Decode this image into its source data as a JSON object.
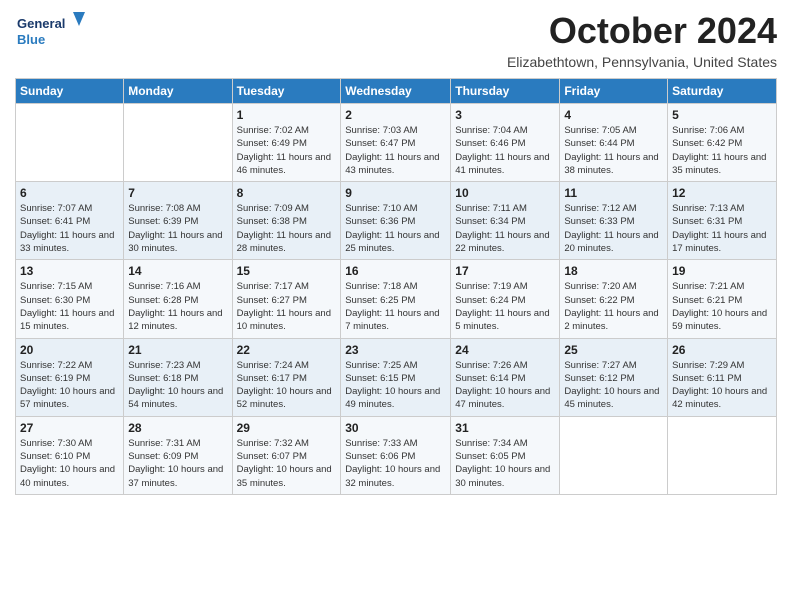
{
  "logo": {
    "general": "General",
    "blue": "Blue"
  },
  "header": {
    "month": "October 2024",
    "location": "Elizabethtown, Pennsylvania, United States"
  },
  "days_of_week": [
    "Sunday",
    "Monday",
    "Tuesday",
    "Wednesday",
    "Thursday",
    "Friday",
    "Saturday"
  ],
  "weeks": [
    [
      {
        "day": "",
        "info": ""
      },
      {
        "day": "",
        "info": ""
      },
      {
        "day": "1",
        "info": "Sunrise: 7:02 AM\nSunset: 6:49 PM\nDaylight: 11 hours and 46 minutes."
      },
      {
        "day": "2",
        "info": "Sunrise: 7:03 AM\nSunset: 6:47 PM\nDaylight: 11 hours and 43 minutes."
      },
      {
        "day": "3",
        "info": "Sunrise: 7:04 AM\nSunset: 6:46 PM\nDaylight: 11 hours and 41 minutes."
      },
      {
        "day": "4",
        "info": "Sunrise: 7:05 AM\nSunset: 6:44 PM\nDaylight: 11 hours and 38 minutes."
      },
      {
        "day": "5",
        "info": "Sunrise: 7:06 AM\nSunset: 6:42 PM\nDaylight: 11 hours and 35 minutes."
      }
    ],
    [
      {
        "day": "6",
        "info": "Sunrise: 7:07 AM\nSunset: 6:41 PM\nDaylight: 11 hours and 33 minutes."
      },
      {
        "day": "7",
        "info": "Sunrise: 7:08 AM\nSunset: 6:39 PM\nDaylight: 11 hours and 30 minutes."
      },
      {
        "day": "8",
        "info": "Sunrise: 7:09 AM\nSunset: 6:38 PM\nDaylight: 11 hours and 28 minutes."
      },
      {
        "day": "9",
        "info": "Sunrise: 7:10 AM\nSunset: 6:36 PM\nDaylight: 11 hours and 25 minutes."
      },
      {
        "day": "10",
        "info": "Sunrise: 7:11 AM\nSunset: 6:34 PM\nDaylight: 11 hours and 22 minutes."
      },
      {
        "day": "11",
        "info": "Sunrise: 7:12 AM\nSunset: 6:33 PM\nDaylight: 11 hours and 20 minutes."
      },
      {
        "day": "12",
        "info": "Sunrise: 7:13 AM\nSunset: 6:31 PM\nDaylight: 11 hours and 17 minutes."
      }
    ],
    [
      {
        "day": "13",
        "info": "Sunrise: 7:15 AM\nSunset: 6:30 PM\nDaylight: 11 hours and 15 minutes."
      },
      {
        "day": "14",
        "info": "Sunrise: 7:16 AM\nSunset: 6:28 PM\nDaylight: 11 hours and 12 minutes."
      },
      {
        "day": "15",
        "info": "Sunrise: 7:17 AM\nSunset: 6:27 PM\nDaylight: 11 hours and 10 minutes."
      },
      {
        "day": "16",
        "info": "Sunrise: 7:18 AM\nSunset: 6:25 PM\nDaylight: 11 hours and 7 minutes."
      },
      {
        "day": "17",
        "info": "Sunrise: 7:19 AM\nSunset: 6:24 PM\nDaylight: 11 hours and 5 minutes."
      },
      {
        "day": "18",
        "info": "Sunrise: 7:20 AM\nSunset: 6:22 PM\nDaylight: 11 hours and 2 minutes."
      },
      {
        "day": "19",
        "info": "Sunrise: 7:21 AM\nSunset: 6:21 PM\nDaylight: 10 hours and 59 minutes."
      }
    ],
    [
      {
        "day": "20",
        "info": "Sunrise: 7:22 AM\nSunset: 6:19 PM\nDaylight: 10 hours and 57 minutes."
      },
      {
        "day": "21",
        "info": "Sunrise: 7:23 AM\nSunset: 6:18 PM\nDaylight: 10 hours and 54 minutes."
      },
      {
        "day": "22",
        "info": "Sunrise: 7:24 AM\nSunset: 6:17 PM\nDaylight: 10 hours and 52 minutes."
      },
      {
        "day": "23",
        "info": "Sunrise: 7:25 AM\nSunset: 6:15 PM\nDaylight: 10 hours and 49 minutes."
      },
      {
        "day": "24",
        "info": "Sunrise: 7:26 AM\nSunset: 6:14 PM\nDaylight: 10 hours and 47 minutes."
      },
      {
        "day": "25",
        "info": "Sunrise: 7:27 AM\nSunset: 6:12 PM\nDaylight: 10 hours and 45 minutes."
      },
      {
        "day": "26",
        "info": "Sunrise: 7:29 AM\nSunset: 6:11 PM\nDaylight: 10 hours and 42 minutes."
      }
    ],
    [
      {
        "day": "27",
        "info": "Sunrise: 7:30 AM\nSunset: 6:10 PM\nDaylight: 10 hours and 40 minutes."
      },
      {
        "day": "28",
        "info": "Sunrise: 7:31 AM\nSunset: 6:09 PM\nDaylight: 10 hours and 37 minutes."
      },
      {
        "day": "29",
        "info": "Sunrise: 7:32 AM\nSunset: 6:07 PM\nDaylight: 10 hours and 35 minutes."
      },
      {
        "day": "30",
        "info": "Sunrise: 7:33 AM\nSunset: 6:06 PM\nDaylight: 10 hours and 32 minutes."
      },
      {
        "day": "31",
        "info": "Sunrise: 7:34 AM\nSunset: 6:05 PM\nDaylight: 10 hours and 30 minutes."
      },
      {
        "day": "",
        "info": ""
      },
      {
        "day": "",
        "info": ""
      }
    ]
  ]
}
